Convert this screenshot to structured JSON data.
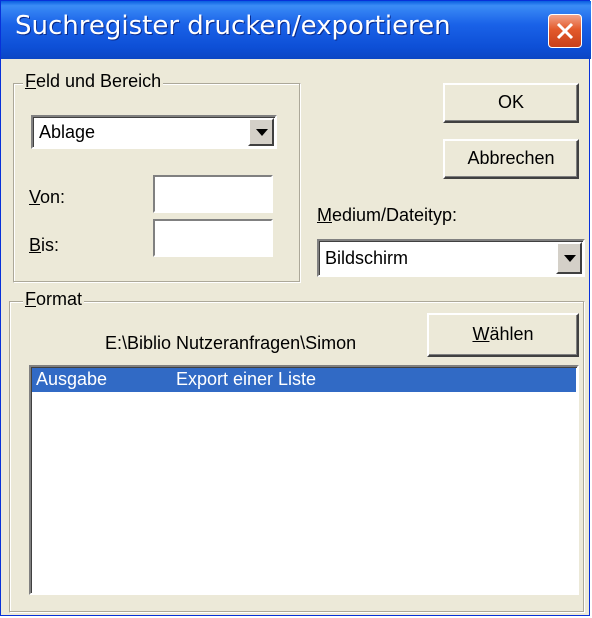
{
  "window": {
    "title": "Suchregister drucken/exportieren"
  },
  "field_group": {
    "label_first": "F",
    "label_rest": "eld und Bereich",
    "field_select_value": "Ablage",
    "von_first": "V",
    "von_rest": "on:",
    "von_value": "",
    "bis_first": "B",
    "bis_rest": "is:",
    "bis_value": ""
  },
  "buttons": {
    "ok": "OK",
    "cancel": "Abbrechen",
    "choose_first": "W",
    "choose_rest": "ählen"
  },
  "medium": {
    "label_first": "M",
    "label_rest": "edium/Dateityp:",
    "value": "Bildschirm"
  },
  "format_group": {
    "label_first": "F",
    "label_rest": "ormat",
    "path": "E:\\Biblio Nutzeranfragen\\Simon",
    "list": [
      {
        "col1": "Ausgabe",
        "col2": "Export einer Liste"
      }
    ]
  },
  "colors": {
    "titlebar": "#0b4fd6",
    "selection": "#316ac5",
    "face": "#ece9d8"
  }
}
